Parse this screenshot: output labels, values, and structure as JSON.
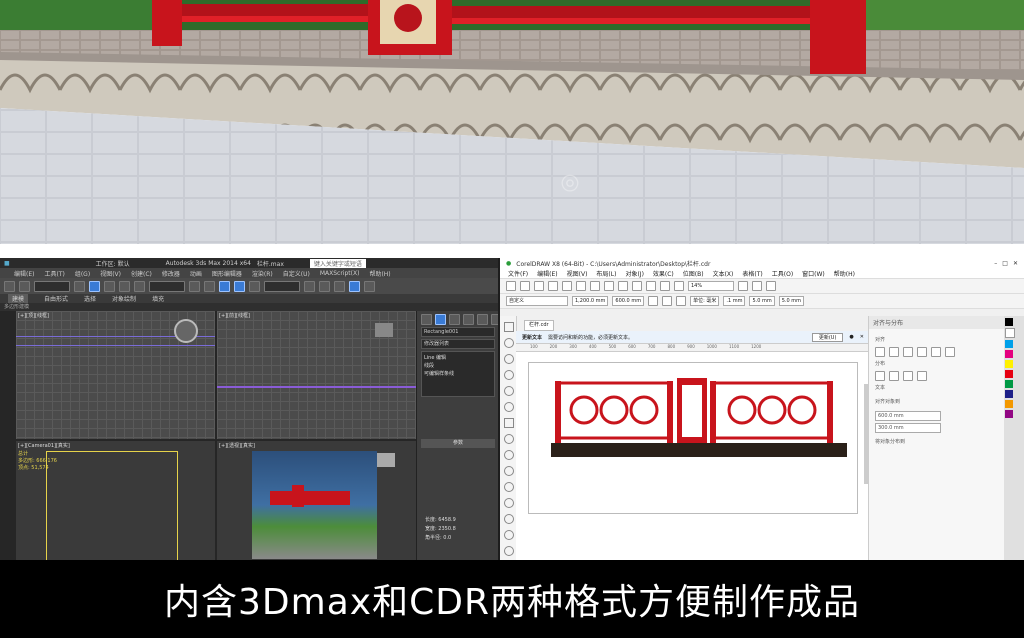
{
  "max": {
    "title": "Autodesk 3ds Max 2014 x64",
    "file": "栏杆.max",
    "workspace": "工作区: 默认",
    "search": "键入关键字或短语",
    "menu": [
      "编辑(E)",
      "工具(T)",
      "组(G)",
      "视图(V)",
      "创建(C)",
      "修改器",
      "动画",
      "图形编辑器",
      "渲染(R)",
      "自定义(U)",
      "MAXScript(X)",
      "帮助(H)"
    ],
    "ribbon": [
      "建模",
      "自由形式",
      "选择",
      "对象绘制",
      "填充"
    ],
    "sub_label": "多边形建模",
    "viewports": {
      "top": "[+][顶][线框]",
      "front": "[+][前][线框]",
      "camera": "[+][Camera01][真实]",
      "persp": "[+][透视][真实]"
    },
    "stats": [
      "总计",
      "多边形: 666,176",
      "顶点: 51,574"
    ],
    "command_panel": {
      "name_field": "Rectangle001",
      "modifier_list": "修改器列表",
      "stack": [
        "Line 编辑",
        "线段",
        "可编辑样条线"
      ],
      "rollout": "参数",
      "params": [
        "长度: 6458.9",
        "宽度: 2350.8",
        "角半径: 0.0"
      ]
    }
  },
  "cdr": {
    "title": "CorelDRAW X8 (64-Bit) - C:\\Users\\Administrator\\Desktop\\栏杆.cdr",
    "menu": [
      "文件(F)",
      "编辑(E)",
      "视图(V)",
      "布局(L)",
      "对象(J)",
      "效果(C)",
      "位图(B)",
      "文本(X)",
      "表格(T)",
      "工具(O)",
      "窗口(W)",
      "帮助(H)"
    ],
    "zoom": "14%",
    "preset": "自定义",
    "width_field": "1,200.0 mm",
    "height_field": "600.0 mm",
    "units": "单位: 毫米",
    "nudge": ".1 mm",
    "dup1": "5.0 mm",
    "dup2": "5.0 mm",
    "doc_tab": "栏杆.cdr",
    "info_bar": {
      "title": "更新文本",
      "message": "需要访问和新的功能，必须更新文本。",
      "button": "更新(U)"
    },
    "ruler": [
      "100",
      "200",
      "300",
      "400",
      "500",
      "600",
      "700",
      "800",
      "900",
      "1000",
      "1100",
      "1200"
    ],
    "docker": {
      "title": "对齐与分布",
      "sections": [
        "对齐",
        "分布",
        "文本",
        "对齐对象到",
        "将对象分布到"
      ],
      "x_value": "600.0 mm",
      "y_value": "300.0 mm"
    }
  },
  "caption": "内含3Dmax和CDR两种格式方便制作成品",
  "colors": {
    "red": "#c8141c",
    "dark": "#2b2b2b"
  }
}
